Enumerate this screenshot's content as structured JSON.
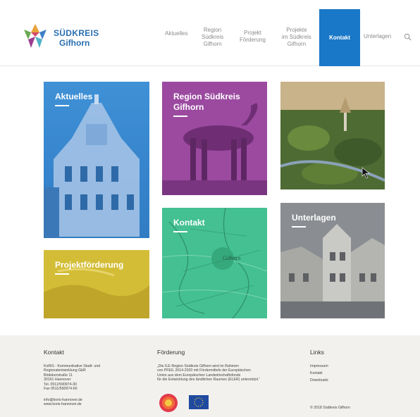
{
  "header": {
    "logo": {
      "line1": "SÜDKREIS",
      "line2": "Gifhorn"
    },
    "nav": [
      {
        "label": "Aktuelles"
      },
      {
        "label": "Region\nSüdkreis\nGifhorn"
      },
      {
        "label": "Projekt\nFörderung"
      },
      {
        "label": "Projekte\nim Südkreis\nGifhorn"
      },
      {
        "label": "Kontakt",
        "active": true
      },
      {
        "label": "Unterlagen"
      }
    ],
    "search_icon": "search-icon"
  },
  "tiles": [
    {
      "id": "aktuelles",
      "title": "Aktuelles"
    },
    {
      "id": "region",
      "title": "Region Südkreis\nGifhorn"
    },
    {
      "id": "photo",
      "title": ""
    },
    {
      "id": "kontakt",
      "title": "Kontakt",
      "map_label": "Gifhorn"
    },
    {
      "id": "projektfoerderung",
      "title": "Projektförderung"
    },
    {
      "id": "unterlagen",
      "title": "Unterlagen"
    }
  ],
  "footer": {
    "kontakt": {
      "heading": "Kontakt",
      "address": "KoRiS - Kommunikative Stadt- und\nRegionalentwicklung GbR\nBödekerstraße 11\n30161 Hannover\nTel. 0511/590974-30\nFax 0511/590974-60",
      "contact": "info@koris-hannover.de\nwww.koris-hannover.de"
    },
    "foerderung": {
      "heading": "Förderung",
      "text": "„Die ILE-Region Südkreis Gifhorn wird im Rahmen\nvon PFEIL 2014-2020 mit Fördermitteln der Europäischen\nUnion aus dem Europäischen Landwirtschaftsfonds\nfür die Entwicklung des ländlichen Raumes (ELER) unterstützt.“"
    },
    "links": {
      "heading": "Links",
      "items": [
        "Impressum",
        "Kontakt",
        "Downloads"
      ],
      "copyright": "© 2018 Südkreis Gifhorn"
    }
  },
  "colors": {
    "accent": "#1a78c8",
    "tile_blue": "#2a7fd0",
    "tile_purple": "#8a3c8f",
    "tile_green": "#3fb98a",
    "tile_yellow": "#d8c13a",
    "footer_bg": "#f3f1ee"
  }
}
